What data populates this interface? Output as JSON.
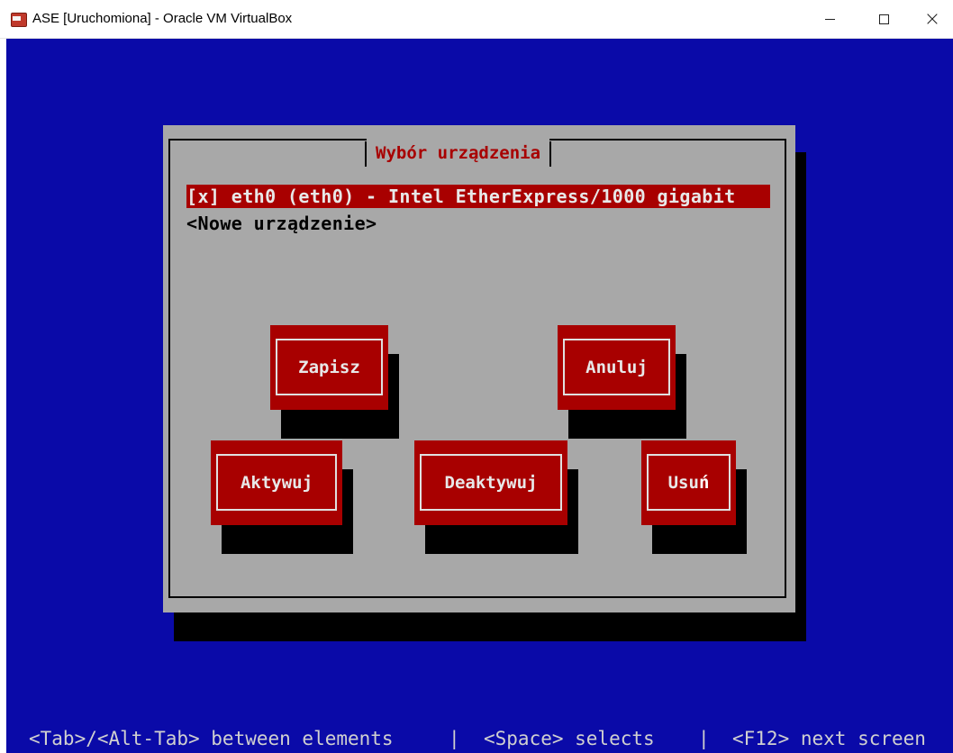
{
  "window": {
    "title": "ASE [Uruchomiona] - Oracle VM VirtualBox",
    "icon": "virtualbox-icon",
    "controls": {
      "minimize": "minimize-icon",
      "maximize": "maximize-icon",
      "close": "×"
    }
  },
  "dialog": {
    "title": "Wybór urządzenia",
    "items": [
      {
        "label": "[x] eth0 (eth0) - Intel EtherExpress/1000 gigabit",
        "selected": true
      },
      {
        "label": "<Nowe urządzenie>",
        "selected": false
      }
    ],
    "buttons": {
      "save": "Zapisz",
      "cancel": "Anuluj",
      "activate": "Aktywuj",
      "deactivate": "Deaktywuj",
      "delete_prefix": "Usu",
      "delete_hotkey": "ń"
    }
  },
  "status": {
    "nav": "<Tab>/<Alt-Tab> between elements",
    "sep1": "|",
    "select": "<Space> selects",
    "sep2": "|",
    "next": "<F12> next screen"
  },
  "colors": {
    "screen_bg": "#0a0aa8",
    "dialog_bg": "#a8a8a8",
    "accent_red": "#a80000",
    "shadow": "#000000"
  }
}
